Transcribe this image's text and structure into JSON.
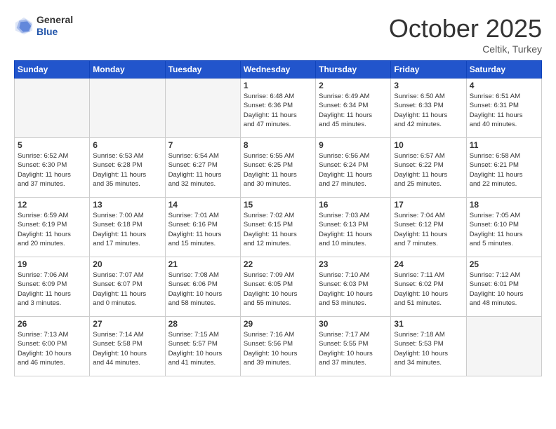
{
  "header": {
    "logo_general": "General",
    "logo_blue": "Blue",
    "month": "October 2025",
    "location": "Celtik, Turkey"
  },
  "days_of_week": [
    "Sunday",
    "Monday",
    "Tuesday",
    "Wednesday",
    "Thursday",
    "Friday",
    "Saturday"
  ],
  "weeks": [
    [
      {
        "day": "",
        "info": ""
      },
      {
        "day": "",
        "info": ""
      },
      {
        "day": "",
        "info": ""
      },
      {
        "day": "1",
        "info": "Sunrise: 6:48 AM\nSunset: 6:36 PM\nDaylight: 11 hours\nand 47 minutes."
      },
      {
        "day": "2",
        "info": "Sunrise: 6:49 AM\nSunset: 6:34 PM\nDaylight: 11 hours\nand 45 minutes."
      },
      {
        "day": "3",
        "info": "Sunrise: 6:50 AM\nSunset: 6:33 PM\nDaylight: 11 hours\nand 42 minutes."
      },
      {
        "day": "4",
        "info": "Sunrise: 6:51 AM\nSunset: 6:31 PM\nDaylight: 11 hours\nand 40 minutes."
      }
    ],
    [
      {
        "day": "5",
        "info": "Sunrise: 6:52 AM\nSunset: 6:30 PM\nDaylight: 11 hours\nand 37 minutes."
      },
      {
        "day": "6",
        "info": "Sunrise: 6:53 AM\nSunset: 6:28 PM\nDaylight: 11 hours\nand 35 minutes."
      },
      {
        "day": "7",
        "info": "Sunrise: 6:54 AM\nSunset: 6:27 PM\nDaylight: 11 hours\nand 32 minutes."
      },
      {
        "day": "8",
        "info": "Sunrise: 6:55 AM\nSunset: 6:25 PM\nDaylight: 11 hours\nand 30 minutes."
      },
      {
        "day": "9",
        "info": "Sunrise: 6:56 AM\nSunset: 6:24 PM\nDaylight: 11 hours\nand 27 minutes."
      },
      {
        "day": "10",
        "info": "Sunrise: 6:57 AM\nSunset: 6:22 PM\nDaylight: 11 hours\nand 25 minutes."
      },
      {
        "day": "11",
        "info": "Sunrise: 6:58 AM\nSunset: 6:21 PM\nDaylight: 11 hours\nand 22 minutes."
      }
    ],
    [
      {
        "day": "12",
        "info": "Sunrise: 6:59 AM\nSunset: 6:19 PM\nDaylight: 11 hours\nand 20 minutes."
      },
      {
        "day": "13",
        "info": "Sunrise: 7:00 AM\nSunset: 6:18 PM\nDaylight: 11 hours\nand 17 minutes."
      },
      {
        "day": "14",
        "info": "Sunrise: 7:01 AM\nSunset: 6:16 PM\nDaylight: 11 hours\nand 15 minutes."
      },
      {
        "day": "15",
        "info": "Sunrise: 7:02 AM\nSunset: 6:15 PM\nDaylight: 11 hours\nand 12 minutes."
      },
      {
        "day": "16",
        "info": "Sunrise: 7:03 AM\nSunset: 6:13 PM\nDaylight: 11 hours\nand 10 minutes."
      },
      {
        "day": "17",
        "info": "Sunrise: 7:04 AM\nSunset: 6:12 PM\nDaylight: 11 hours\nand 7 minutes."
      },
      {
        "day": "18",
        "info": "Sunrise: 7:05 AM\nSunset: 6:10 PM\nDaylight: 11 hours\nand 5 minutes."
      }
    ],
    [
      {
        "day": "19",
        "info": "Sunrise: 7:06 AM\nSunset: 6:09 PM\nDaylight: 11 hours\nand 3 minutes."
      },
      {
        "day": "20",
        "info": "Sunrise: 7:07 AM\nSunset: 6:07 PM\nDaylight: 11 hours\nand 0 minutes."
      },
      {
        "day": "21",
        "info": "Sunrise: 7:08 AM\nSunset: 6:06 PM\nDaylight: 10 hours\nand 58 minutes."
      },
      {
        "day": "22",
        "info": "Sunrise: 7:09 AM\nSunset: 6:05 PM\nDaylight: 10 hours\nand 55 minutes."
      },
      {
        "day": "23",
        "info": "Sunrise: 7:10 AM\nSunset: 6:03 PM\nDaylight: 10 hours\nand 53 minutes."
      },
      {
        "day": "24",
        "info": "Sunrise: 7:11 AM\nSunset: 6:02 PM\nDaylight: 10 hours\nand 51 minutes."
      },
      {
        "day": "25",
        "info": "Sunrise: 7:12 AM\nSunset: 6:01 PM\nDaylight: 10 hours\nand 48 minutes."
      }
    ],
    [
      {
        "day": "26",
        "info": "Sunrise: 7:13 AM\nSunset: 6:00 PM\nDaylight: 10 hours\nand 46 minutes."
      },
      {
        "day": "27",
        "info": "Sunrise: 7:14 AM\nSunset: 5:58 PM\nDaylight: 10 hours\nand 44 minutes."
      },
      {
        "day": "28",
        "info": "Sunrise: 7:15 AM\nSunset: 5:57 PM\nDaylight: 10 hours\nand 41 minutes."
      },
      {
        "day": "29",
        "info": "Sunrise: 7:16 AM\nSunset: 5:56 PM\nDaylight: 10 hours\nand 39 minutes."
      },
      {
        "day": "30",
        "info": "Sunrise: 7:17 AM\nSunset: 5:55 PM\nDaylight: 10 hours\nand 37 minutes."
      },
      {
        "day": "31",
        "info": "Sunrise: 7:18 AM\nSunset: 5:53 PM\nDaylight: 10 hours\nand 34 minutes."
      },
      {
        "day": "",
        "info": ""
      }
    ]
  ]
}
